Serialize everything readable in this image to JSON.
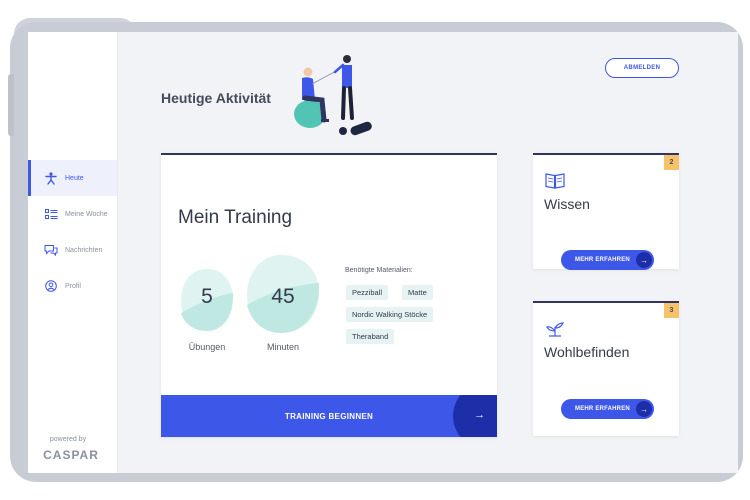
{
  "sidebar": {
    "items": [
      {
        "label": "Heute",
        "icon": "person-activity-icon",
        "active": true
      },
      {
        "label": "Meine Woche",
        "icon": "week-list-icon",
        "active": false
      },
      {
        "label": "Nachrichten",
        "icon": "chat-icon",
        "active": false
      },
      {
        "label": "Profil",
        "icon": "profile-icon",
        "active": false
      }
    ],
    "powered_by": "powered by",
    "brand": "CASPAR"
  },
  "header": {
    "title": "Heutige Aktivität",
    "logout_label": "ABMELDEN"
  },
  "training": {
    "title": "Mein Training",
    "stats": [
      {
        "value": "5",
        "label": "Übungen"
      },
      {
        "value": "45",
        "label": "Minuten"
      }
    ],
    "materials_title": "Benötigte Materialien:",
    "materials": [
      "Pezziball",
      "Matte",
      "Nordic Walking Stöcke",
      "Theraband"
    ],
    "cta_label": "TRAINING BEGINNEN",
    "cta_arrow": "→"
  },
  "cards": [
    {
      "title": "Wissen",
      "badge": "2",
      "icon": "book-icon",
      "button_label": "MEHR ERFAHREN",
      "arrow": "→"
    },
    {
      "title": "Wohlbefinden",
      "badge": "3",
      "icon": "plant-icon",
      "button_label": "MEHR ERFAHREN",
      "arrow": "→"
    }
  ],
  "colors": {
    "accent": "#3d57e8",
    "accent_dark": "#1d2ea8",
    "card_border": "#2f3560",
    "badge": "#f7c26a",
    "blob": "#bfe8e3",
    "chip": "#e6f3f2"
  }
}
